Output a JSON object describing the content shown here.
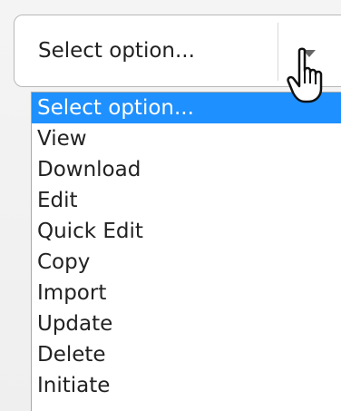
{
  "select": {
    "value": "Select option...",
    "options": [
      "Select option...",
      "View",
      "Download",
      "Edit",
      "Quick Edit",
      "Copy",
      "Import",
      "Update",
      "Delete",
      "Initiate"
    ],
    "highlighted_index": 0
  },
  "colors": {
    "highlight": "#1e90ff",
    "text": "#222222",
    "border": "#b8b8b8"
  },
  "icons": {
    "arrow": "chevron-down-icon",
    "cursor": "hand-pointer-icon"
  }
}
